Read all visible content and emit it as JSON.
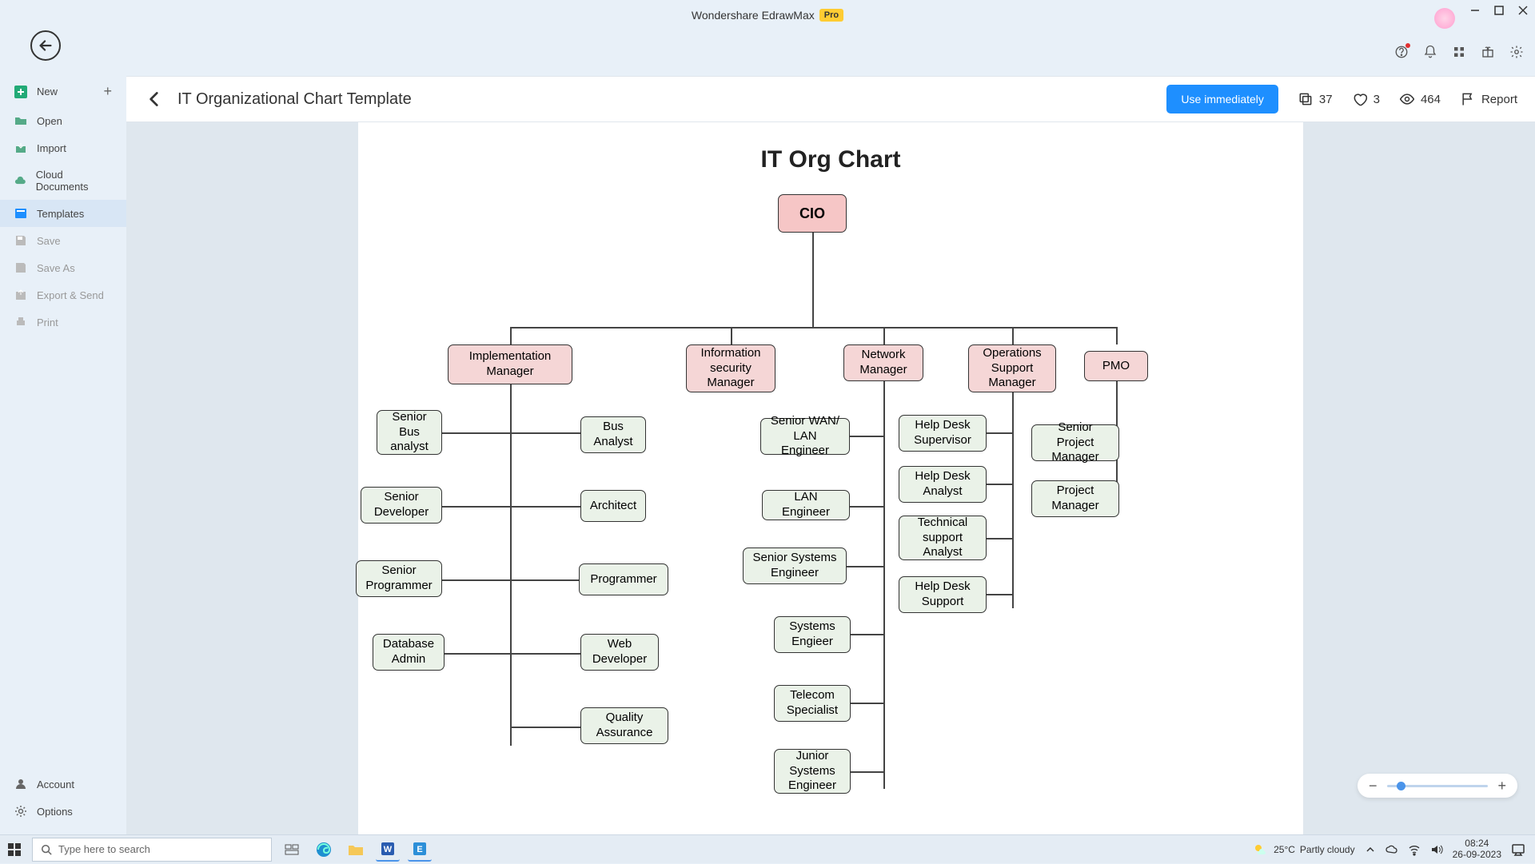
{
  "app": {
    "title": "Wondershare EdrawMax",
    "badge": "Pro"
  },
  "sidebar": {
    "items": [
      {
        "label": "New"
      },
      {
        "label": "Open"
      },
      {
        "label": "Import"
      },
      {
        "label": "Cloud Documents"
      },
      {
        "label": "Templates"
      },
      {
        "label": "Save"
      },
      {
        "label": "Save As"
      },
      {
        "label": "Export & Send"
      },
      {
        "label": "Print"
      }
    ],
    "bottom": [
      {
        "label": "Account"
      },
      {
        "label": "Options"
      }
    ]
  },
  "head": {
    "title": "IT Organizational Chart Template",
    "use": "Use immediately",
    "copy": "37",
    "like": "3",
    "views": "464",
    "report": "Report"
  },
  "chart": {
    "title": "IT Org Chart",
    "nodes": {
      "cio": "CIO",
      "impl": "Implementation Manager",
      "infosec": "Information security Manager",
      "net": "Network Manager",
      "ops": "Operations Support Manager",
      "pmo": "PMO",
      "sba": "Senior Bus analyst",
      "ba": "Bus Analyst",
      "sdev": "Senior Developer",
      "arch": "Architect",
      "sprog": "Senior Programmer",
      "prog": "Programmer",
      "dba": "Database Admin",
      "web": "Web Developer",
      "qa": "Quality Assurance",
      "swan": "Senior WAN/ LAN Engineer",
      "lan": "LAN Engineer",
      "sse": "Senior Systems Engineer",
      "syse": "Systems Engieer",
      "tel": "Telecom Specialist",
      "jse": "Junior Systems Engineer",
      "hds": "Help Desk Supervisor",
      "hda": "Help Desk Analyst",
      "tsa": "Technical support Analyst",
      "hdsu": "Help Desk Support",
      "spm": "Senior Project Manager",
      "pm": "Project Manager"
    }
  },
  "taskbar": {
    "search": "Type here to search",
    "weather_temp": "25°C",
    "weather_text": "Partly cloudy",
    "time": "08:24",
    "date": "26-09-2023"
  }
}
